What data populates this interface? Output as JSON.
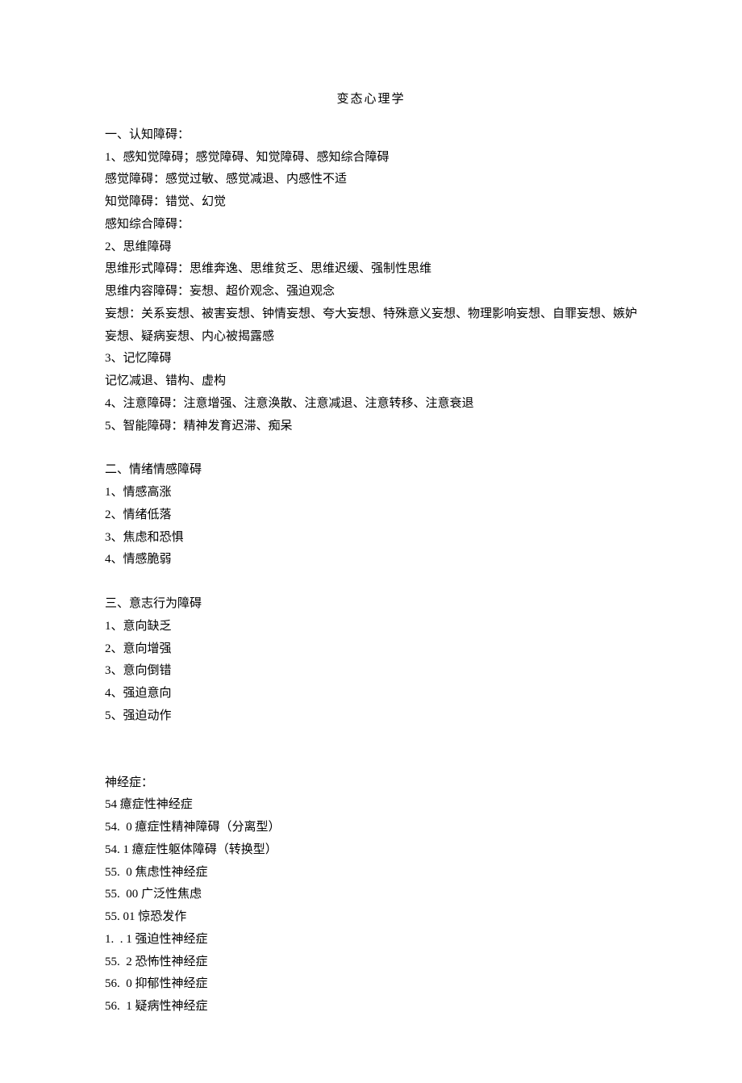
{
  "title": "变态心理学",
  "section1": {
    "heading": "一、认知障碍：",
    "lines": [
      "1、感知觉障碍；感觉障碍、知觉障碍、感知综合障碍",
      "感觉障碍：感觉过敏、感觉减退、内感性不适",
      "知觉障碍：错觉、幻觉",
      "感知综合障碍：",
      "2、思维障碍",
      "思维形式障碍：思维奔逸、思维贫乏、思维迟缓、强制性思维",
      "思维内容障碍：妄想、超价观念、强迫观念",
      "妄想：关系妄想、被害妄想、钟情妄想、夸大妄想、特殊意义妄想、物理影响妄想、自罪妄想、嫉妒妄想、疑病妄想、内心被揭露感",
      "3、记忆障碍",
      "记忆减退、错构、虚构",
      "4、注意障碍：注意增强、注意涣散、注意减退、注意转移、注意衰退",
      "5、智能障碍：精神发育迟滞、痴呆"
    ]
  },
  "section2": {
    "heading": "二、情绪情感障碍",
    "lines": [
      "1、情感高涨",
      "2、情绪低落",
      "3、焦虑和恐惧",
      "4、情感脆弱"
    ]
  },
  "section3": {
    "heading": "三、意志行为障碍",
    "lines": [
      "1、意向缺乏",
      "2、意向增强",
      "3、意向倒错",
      "4、强迫意向",
      "5、强迫动作"
    ]
  },
  "section4": {
    "heading": "神经症：",
    "lines": [
      "54 癔症性神经症",
      "54.  0 癔症性精神障碍（分离型）",
      "54. 1 癔症性躯体障碍（转换型）",
      "55.  0 焦虑性神经症",
      "55.  00 广泛性焦虑",
      "55. 01 惊恐发作",
      "1.  . 1 强迫性神经症",
      "55.  2 恐怖性神经症",
      "56.  0 抑郁性神经症",
      "56.  1 疑病性神经症"
    ]
  }
}
